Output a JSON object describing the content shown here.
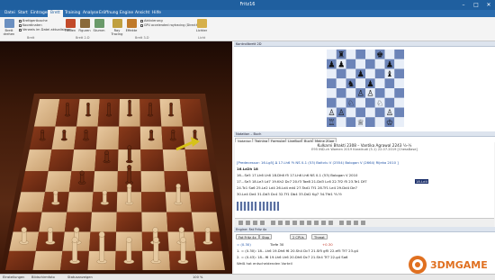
{
  "app": {
    "title": "Fritz16"
  },
  "tabs": [
    "Datei",
    "Start",
    "Eintragen",
    "Brett",
    "Training",
    "Analyse",
    "Eröffnung",
    "Engine",
    "Ansicht",
    "Hilfe"
  ],
  "active_tab": 3,
  "ribbon": {
    "buttons": [
      {
        "label": "Brett drehen",
        "color": "#6a8fc0"
      },
      {
        "label": "Farben",
        "color": "#c24a2a"
      },
      {
        "label": "Figuren",
        "color": "#8a6a3a"
      },
      {
        "label": "Stumm",
        "color": "#6a9a6a"
      },
      {
        "label": "Ray Tracing",
        "color": "#c0a040"
      },
      {
        "label": "Effekte",
        "color": "#c07a2a"
      },
      {
        "label": "Lichter",
        "color": "#d6b04a"
      }
    ],
    "checks": [
      "Brettgeräusche",
      "Koordinaten",
      "Verweis im Datei aktualisieren",
      "Aktivierung",
      "GPU accelerated raytracing (DirectX 12)"
    ],
    "groups": [
      "Brett",
      "Brett 2-D",
      "Brett 3-D",
      "Licht"
    ]
  },
  "panels": {
    "board2d": "Kontrollbrett 2D",
    "notation": "Notation – Buch",
    "engine": "Engine: Fat Fritz 4x"
  },
  "notation_tabs": [
    "Notation",
    "Training",
    "Formular",
    "LiveBuch",
    "Buch",
    "Meine Züge"
  ],
  "game": {
    "white": "Kulkarni Bhakti 2308",
    "black": "Vantika Agrawal 2243",
    "result": "½-½",
    "event": "E95 IND-ch Women 2019 Karaikudi (5.1) 22.07.2019 [ChessBase]",
    "predecessor": "[Predecessor: 16.Lg5] ∆ 17.Lh6 ½ NS 0-1 (53) Baitvlu V (2554) Bologan V (2664) Rijeka 2010 ]",
    "line1": "16.Ld2h 18",
    "line2": "16...Se5 17.Lh6 Lh6 18.Dh6 f5 17.Lh6 Lh6 NS 0-1 (53) Bologan V 2010",
    "line3": "17...Se3 18.Le3 Ld7 19.Kh2 Dc7 20.f3 Tae8 21.Dd3 Lc6 22.Tf2 f5 23.Te1 Df7",
    "line4": "24.Tc1 Sa6 25.Le2 Ld4 26.Ld4 ed4 27.Tad1 Tf1 28.Tf1 Le4 29.Dd4 De7",
    "line5": "30.Le4 De4 31.Dd3 Dc4 32.Tf1 Db4 33.Dd2 Kg7 34.Tfd1 ½-½",
    "current": "18.Ld4"
  },
  "engine": {
    "buttons": [
      "Fat Fritz 4x",
      "Stop",
      "2 CPUs",
      "Threat"
    ],
    "depth": "Tiefe 30",
    "score": "+0.30",
    "evaluation": "= (0.30)",
    "line1": "1. = (0.30): 18...Lh6 19.Dh6 f6 20.Sh4 Dc7 21.Sf5 gf5 22.ef5 Tf7 23.g4",
    "line2": "2. = (0.43): 18...f6 19.Lh6 Lh6 20.Dh6 Dc7 21.Sh4 Tf7 22.g4 Sa6",
    "note": "Weiß hat entscheidenden Vorteil"
  },
  "status": {
    "left": "Einstellungen",
    "middle": "Bildschirmfoto",
    "right": "Statusanzeigen",
    "zoom": "100 %"
  },
  "watermark": {
    "text": "3DMGAME"
  }
}
